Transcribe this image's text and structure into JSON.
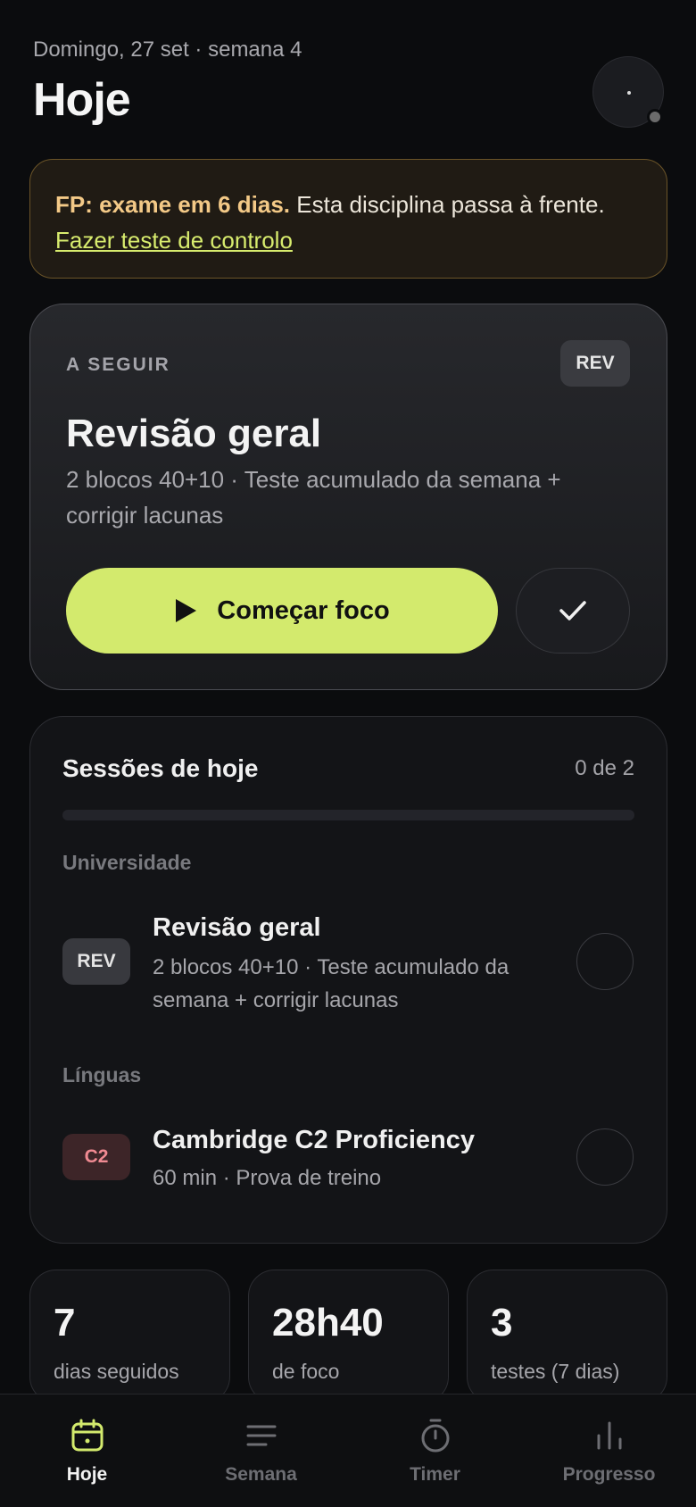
{
  "header": {
    "date": "Domingo, 27 set · semana 4",
    "title": "Hoje"
  },
  "alert": {
    "bold": "FP: exame em 6 dias.",
    "text": " Esta disciplina passa à frente.",
    "link": "Fazer teste de controlo",
    "accent_color": "#f3c987"
  },
  "next": {
    "kicker": "A SEGUIR",
    "tag": "REV",
    "title": "Revisão geral",
    "subtitle": "2 blocos 40+10 · Teste acumulado da semana + corrigir lacunas",
    "start_label": "Começar foco",
    "start_icon": "play-icon",
    "done_icon": "check-icon",
    "accent_color": "#d3ea6d"
  },
  "sessions": {
    "title": "Sessões de hoje",
    "count": "0 de 2",
    "progress": 0,
    "groups": [
      {
        "label": "Universidade",
        "item": {
          "tag": "REV",
          "title": "Revisão geral",
          "subtitle": "2 blocos 40+10 · Teste acumulado da semana + corrigir lacunas",
          "done": false
        }
      },
      {
        "label": "Línguas",
        "item": {
          "tag": "C2",
          "title": "Cambridge C2 Proficiency",
          "subtitle": "60 min · Prova de treino",
          "done": false
        }
      }
    ]
  },
  "stats": [
    {
      "value": "7",
      "label": "dias seguidos"
    },
    {
      "value": "28h40",
      "label": "de foco"
    },
    {
      "value": "3",
      "label": "testes (7 dias)"
    }
  ],
  "tabs": [
    {
      "label": "Hoje",
      "icon": "calendar-icon",
      "active": true
    },
    {
      "label": "Semana",
      "icon": "list-icon",
      "active": false
    },
    {
      "label": "Timer",
      "icon": "stopwatch-icon",
      "active": false
    },
    {
      "label": "Progresso",
      "icon": "bar-chart-icon",
      "active": false
    }
  ]
}
